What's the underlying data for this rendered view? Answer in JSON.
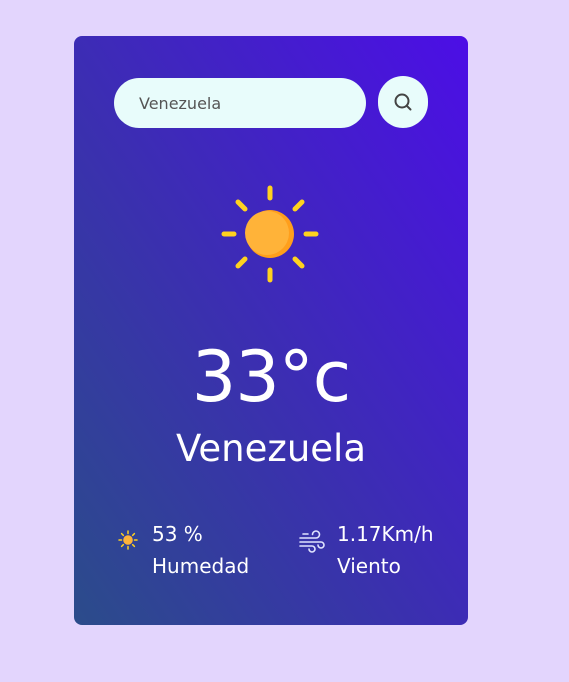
{
  "search": {
    "placeholder": "Venezuela",
    "icon": "search-icon"
  },
  "weather": {
    "condition_icon": "sun-icon",
    "temperature": "33°c",
    "city": "Venezuela"
  },
  "details": {
    "humidity": {
      "value": "53 %",
      "label": "Humedad",
      "icon": "sun-small-icon"
    },
    "wind": {
      "value": "1.17Km/h",
      "label": "Viento",
      "icon": "wind-icon"
    }
  },
  "colors": {
    "background": "#e3d5fd",
    "card_gradient_top": "#4c0ee6",
    "card_gradient_bottom": "#2b4c8a",
    "input_bg": "#e8fcfb",
    "sun": "#ffb339",
    "sun_rays": "#ffd21f"
  }
}
